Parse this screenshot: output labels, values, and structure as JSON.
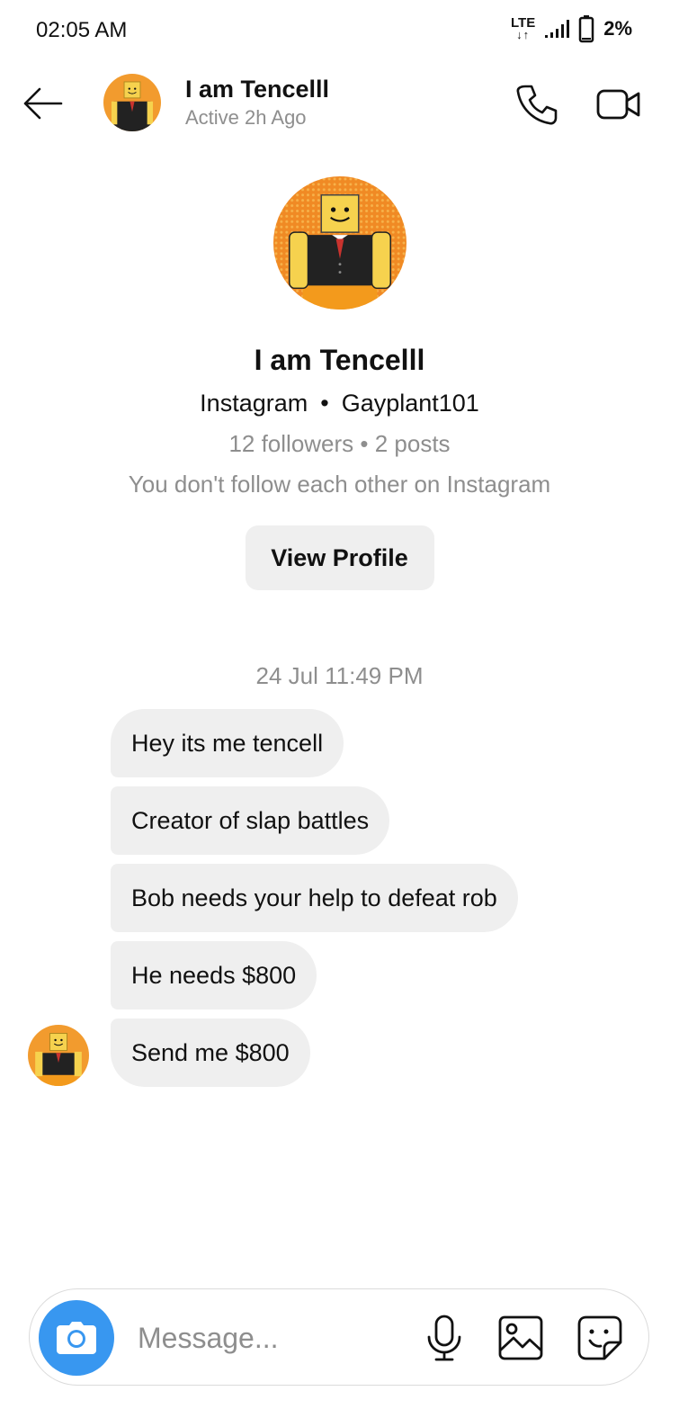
{
  "status_bar": {
    "time": "02:05 AM",
    "network": "LTE",
    "battery": "2%"
  },
  "header": {
    "name": "I am Tencelll",
    "active": "Active 2h Ago"
  },
  "profile": {
    "name": "I am Tencelll",
    "platform": "Instagram",
    "separator": "•",
    "username": "Gayplant101",
    "stats": "12 followers • 2 posts",
    "note": "You don't follow each other on Instagram",
    "view_button": "View Profile"
  },
  "conversation": {
    "timestamp": "24 Jul 11:49 PM",
    "messages": [
      "Hey its me tencell",
      "Creator of slap battles",
      "Bob needs your help to defeat rob",
      "He needs $800",
      "Send me $800"
    ]
  },
  "composer": {
    "placeholder": "Message..."
  },
  "colors": {
    "accent": "#3897f0",
    "bubble": "#efefef",
    "muted_text": "#8e8e8e"
  },
  "icons": [
    "back-arrow-icon",
    "phone-icon",
    "video-camera-icon",
    "camera-icon",
    "microphone-icon",
    "gallery-icon",
    "sticker-icon"
  ]
}
